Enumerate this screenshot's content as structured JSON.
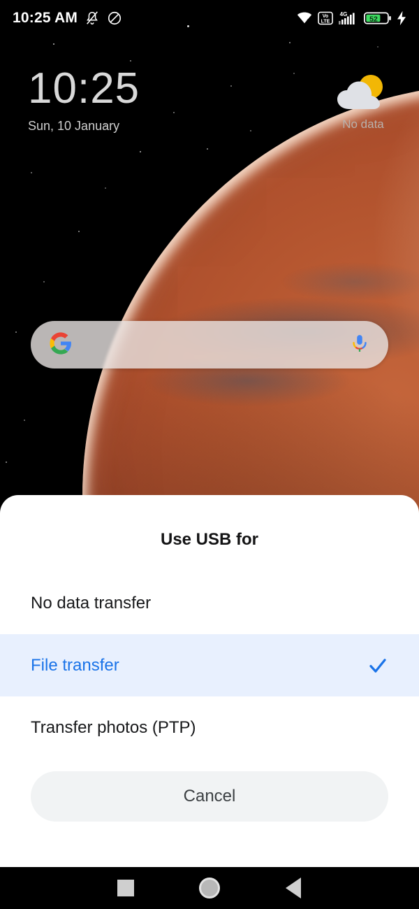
{
  "statusbar": {
    "time": "10:25 AM",
    "left_icons": [
      {
        "name": "silent-bell-icon",
        "label": "Silent"
      },
      {
        "name": "do-not-disturb-icon",
        "label": "Do not disturb"
      }
    ],
    "right_icons": [
      {
        "name": "wifi-icon",
        "label": "Wi-Fi"
      },
      {
        "name": "volte-icon",
        "label": "VoLTE"
      },
      {
        "name": "signal-4g-icon",
        "label": "4G"
      },
      {
        "name": "battery-icon",
        "label": "52"
      },
      {
        "name": "charging-bolt-icon",
        "label": "Charging"
      }
    ],
    "battery_level": "52",
    "network_type": "4G",
    "volte_line1": "Vo",
    "volte_line2": "LTE"
  },
  "lockscreen": {
    "clock_time": "10:25",
    "clock_date": "Sun, 10 January",
    "weather_text": "No data",
    "weather_icon": "sun-behind-cloud-icon"
  },
  "search": {
    "value": "",
    "placeholder": "",
    "logo_icon": "google-g-icon",
    "mic_icon": "google-mic-icon"
  },
  "sheet": {
    "title": "Use USB for",
    "options": [
      {
        "label": "No data transfer",
        "selected": false
      },
      {
        "label": "File transfer",
        "selected": true
      },
      {
        "label": "Transfer photos (PTP)",
        "selected": false
      }
    ],
    "cancel_label": "Cancel",
    "check_icon": "check-icon"
  },
  "navbar": {
    "recents_label": "Recents",
    "home_label": "Home",
    "back_label": "Back"
  },
  "colors": {
    "accent_blue": "#1a73e8",
    "selected_row_bg": "#e8f0fe",
    "cancel_bg": "#f1f3f4",
    "sheet_bg": "#ffffff",
    "battery_green": "#3ddc61"
  }
}
